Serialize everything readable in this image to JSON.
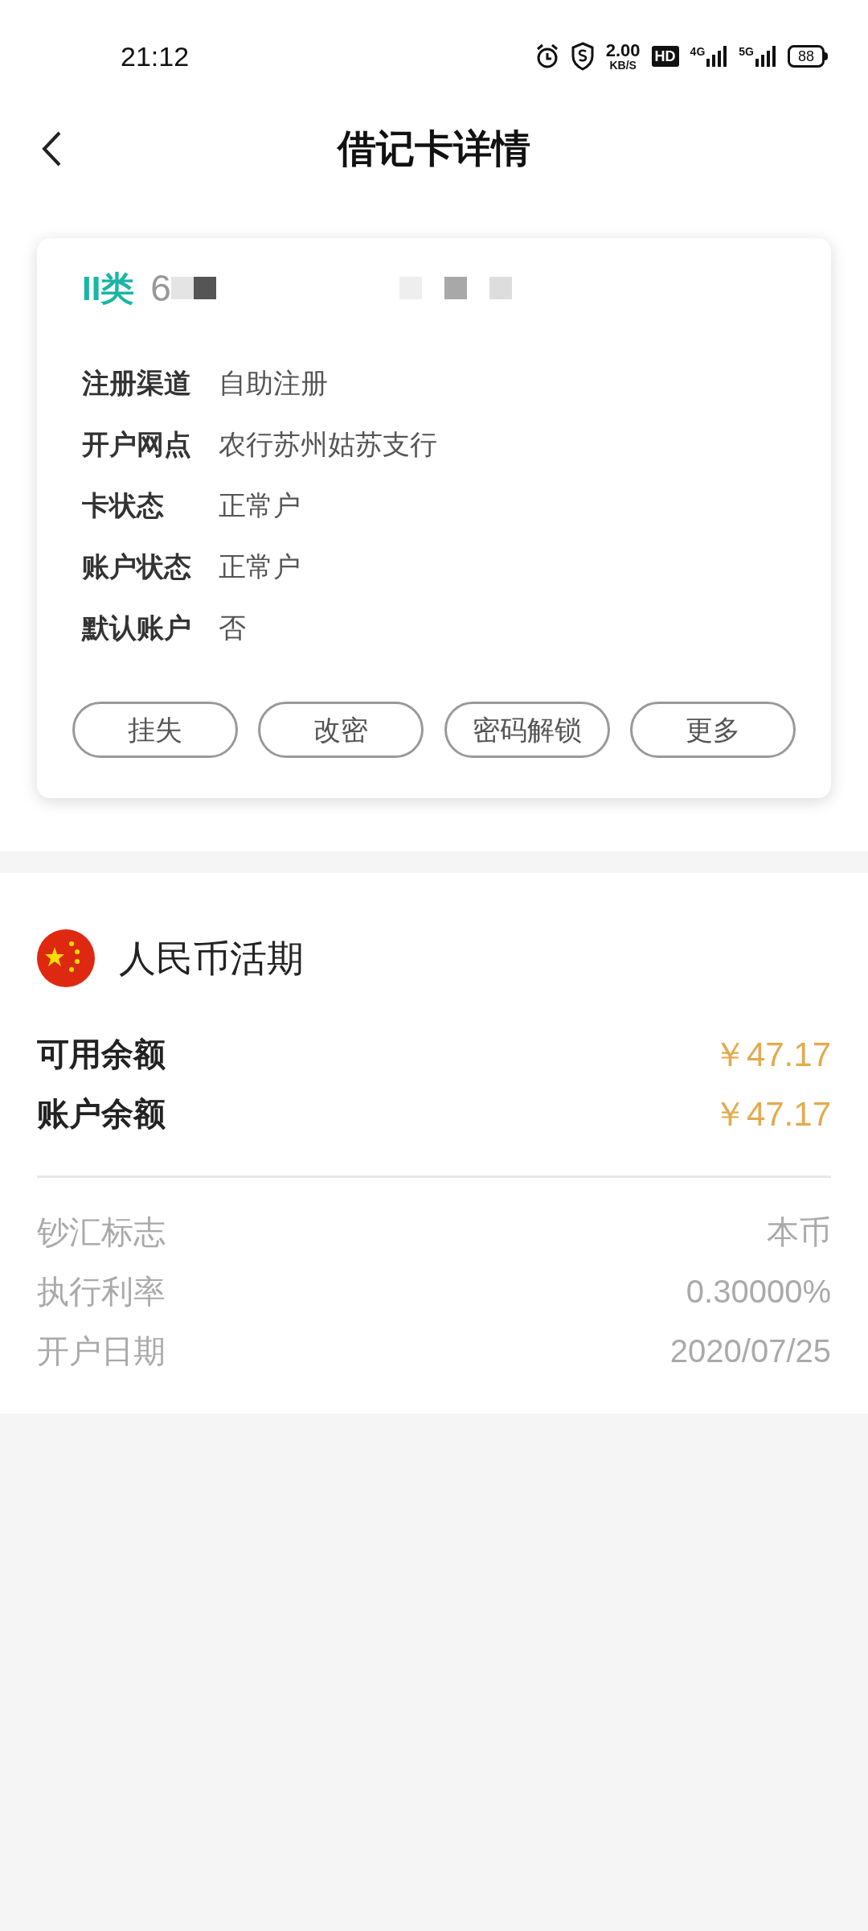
{
  "status_bar": {
    "time": "21:12",
    "speed": "2.00",
    "speed_unit": "KB/S",
    "hd": "HD",
    "net1": "4G",
    "net2": "5G",
    "battery": "88"
  },
  "header": {
    "title": "借记卡详情"
  },
  "card": {
    "class_label": "II类",
    "number": "6",
    "fields": [
      {
        "label": "注册渠道",
        "value": "自助注册"
      },
      {
        "label": "开户网点",
        "value": "农行苏州姑苏支行"
      },
      {
        "label": "卡状态",
        "value": "正常户"
      },
      {
        "label": "账户状态",
        "value": "正常户"
      },
      {
        "label": "默认账户",
        "value": "否"
      }
    ],
    "buttons": [
      "挂失",
      "改密",
      "密码解锁",
      "更多"
    ]
  },
  "account": {
    "title": "人民币活期",
    "balances": [
      {
        "label": "可用余额",
        "value": "￥47.17"
      },
      {
        "label": "账户余额",
        "value": "￥47.17"
      }
    ],
    "details": [
      {
        "label": "钞汇标志",
        "value": "本币"
      },
      {
        "label": "执行利率",
        "value": "0.30000%"
      },
      {
        "label": "开户日期",
        "value": "2020/07/25"
      }
    ]
  }
}
